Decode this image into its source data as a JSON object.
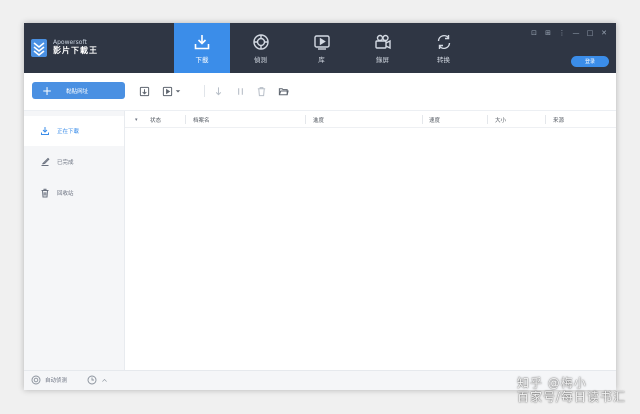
{
  "app": {
    "brand_en": "Apowersoft",
    "brand_cn": "影片下載王"
  },
  "tabs": [
    {
      "label": "下載",
      "icon": "download-icon",
      "active": true
    },
    {
      "label": "偵測",
      "icon": "detect-icon",
      "active": false
    },
    {
      "label": "库",
      "icon": "library-icon",
      "active": false
    },
    {
      "label": "錄屏",
      "icon": "camera-icon",
      "active": false
    },
    {
      "label": "转换",
      "icon": "convert-icon",
      "active": false
    }
  ],
  "window_controls": {
    "cart": "⊡",
    "settings": "⊞",
    "menu": "⋮",
    "minimize": "—",
    "maximize": "□",
    "close": "✕"
  },
  "login_label": "登录",
  "toolbar": {
    "paste_label": "黏贴网址"
  },
  "sidebar": [
    {
      "label": "正在下載",
      "icon": "download-icon",
      "active": true
    },
    {
      "label": "已完成",
      "icon": "completed-icon",
      "active": false
    },
    {
      "label": "回收站",
      "icon": "trash-icon",
      "active": false
    }
  ],
  "table": {
    "columns": [
      "状态",
      "档案名",
      "進度",
      "速度",
      "大小",
      "来源"
    ]
  },
  "statusbar": {
    "auto_detect": "自动侦测"
  },
  "watermark": "知乎 @梅小\n百家号/每日读书汇",
  "colors": {
    "accent": "#3b8de9",
    "titlebar": "#2f3644",
    "sidebar": "#f5f6f8"
  }
}
